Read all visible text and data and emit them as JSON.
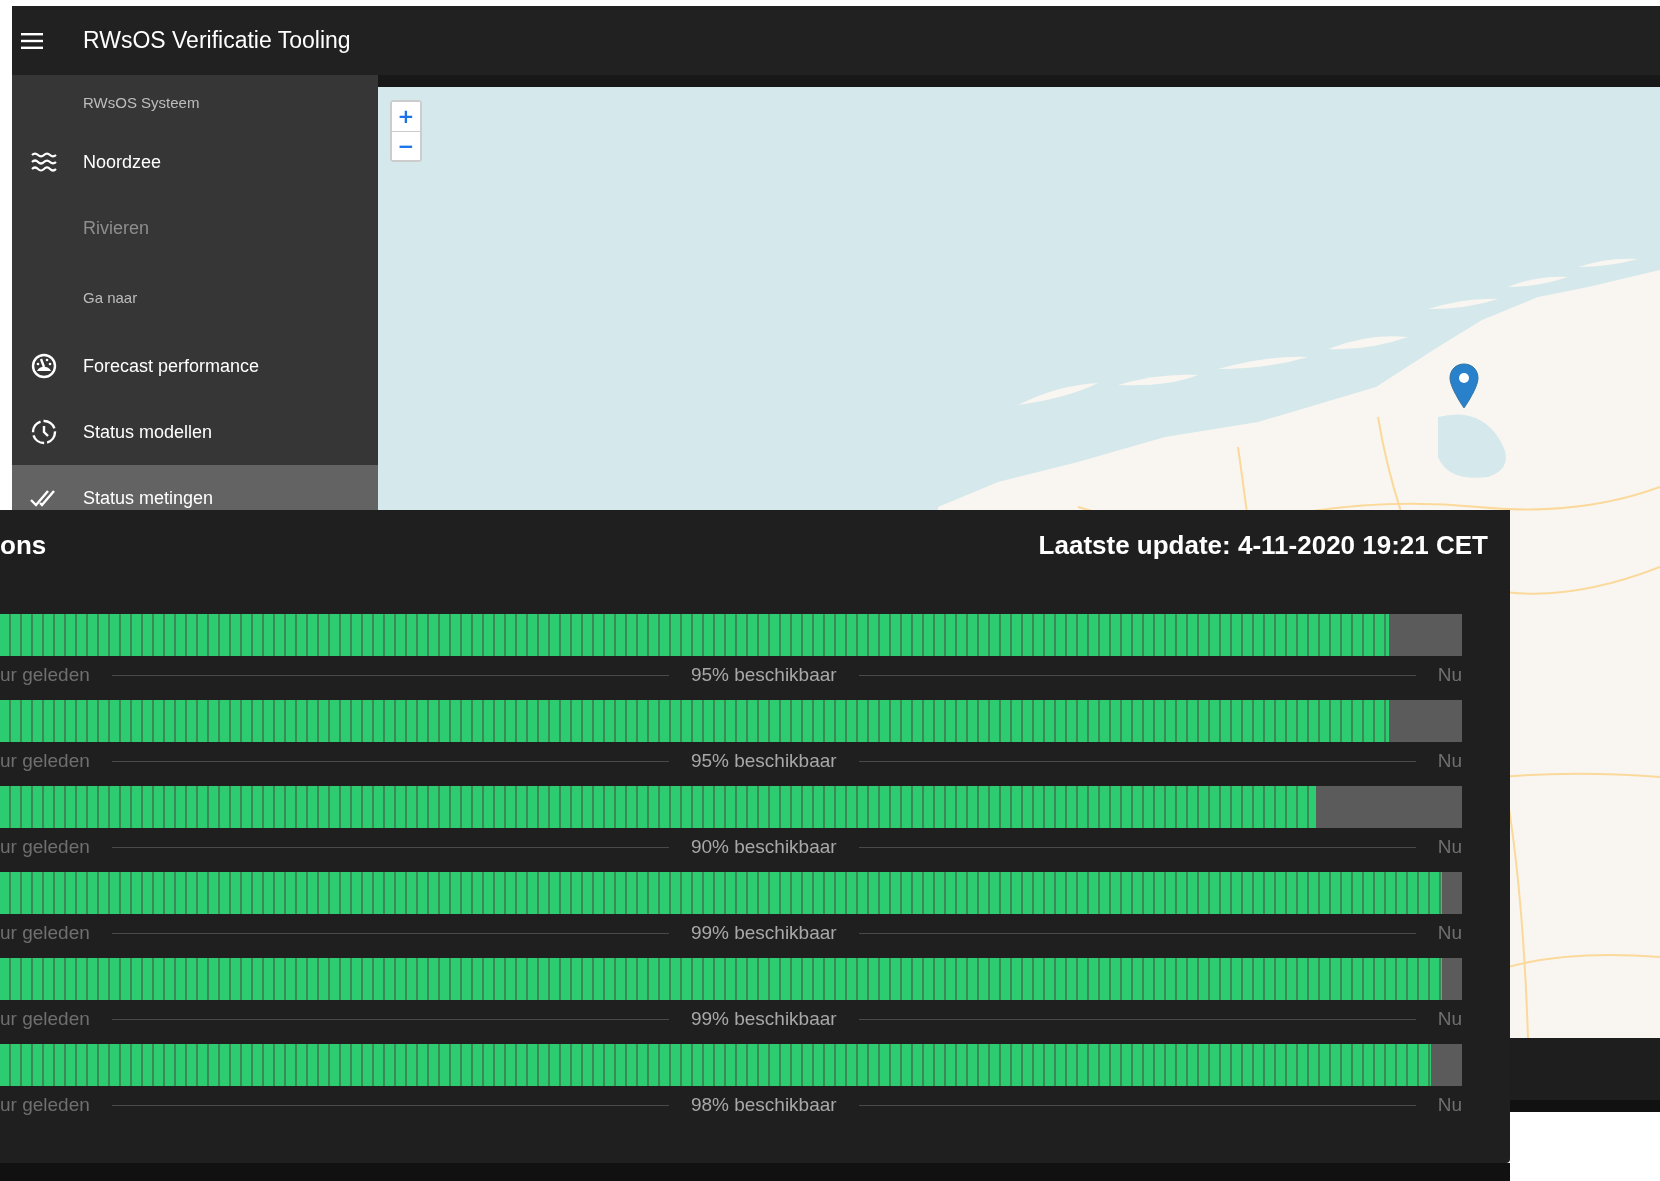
{
  "app_bar": {
    "title": "RWsOS Verificatie Tooling"
  },
  "sidebar": {
    "items": [
      {
        "kind": "header",
        "label": "RWsOS Systeem"
      },
      {
        "kind": "item",
        "label": "Noordzee",
        "disabled": false,
        "selected": false
      },
      {
        "kind": "item",
        "label": "Rivieren",
        "disabled": true,
        "selected": false
      },
      {
        "kind": "header",
        "label": "Ga naar"
      },
      {
        "kind": "item",
        "label": "Forecast performance",
        "disabled": false,
        "selected": false
      },
      {
        "kind": "item",
        "label": "Status modellen",
        "disabled": false,
        "selected": false
      },
      {
        "kind": "item",
        "label": "Status metingen",
        "disabled": false,
        "selected": true
      }
    ]
  },
  "map": {
    "zoom_in": "+",
    "zoom_out": "−"
  },
  "panel": {
    "title": "ons",
    "last_update": "Laatste update: 4-11-2020 19:21 CET",
    "rows": [
      {
        "level": 0.95,
        "start_label": "ur geleden",
        "availability": "95% beschikbaar",
        "end_label": "Nu"
      },
      {
        "level": 0.95,
        "start_label": "ur geleden",
        "availability": "95% beschikbaar",
        "end_label": "Nu"
      },
      {
        "level": 0.9,
        "start_label": "ur geleden",
        "availability": "90% beschikbaar",
        "end_label": "Nu"
      },
      {
        "level": 0.986,
        "start_label": "ur geleden",
        "availability": "99% beschikbaar",
        "end_label": "Nu"
      },
      {
        "level": 0.986,
        "start_label": "ur geleden",
        "availability": "99% beschikbaar",
        "end_label": "Nu"
      },
      {
        "level": 0.979,
        "start_label": "ur geleden",
        "availability": "98% beschikbaar",
        "end_label": "Nu"
      }
    ]
  }
}
